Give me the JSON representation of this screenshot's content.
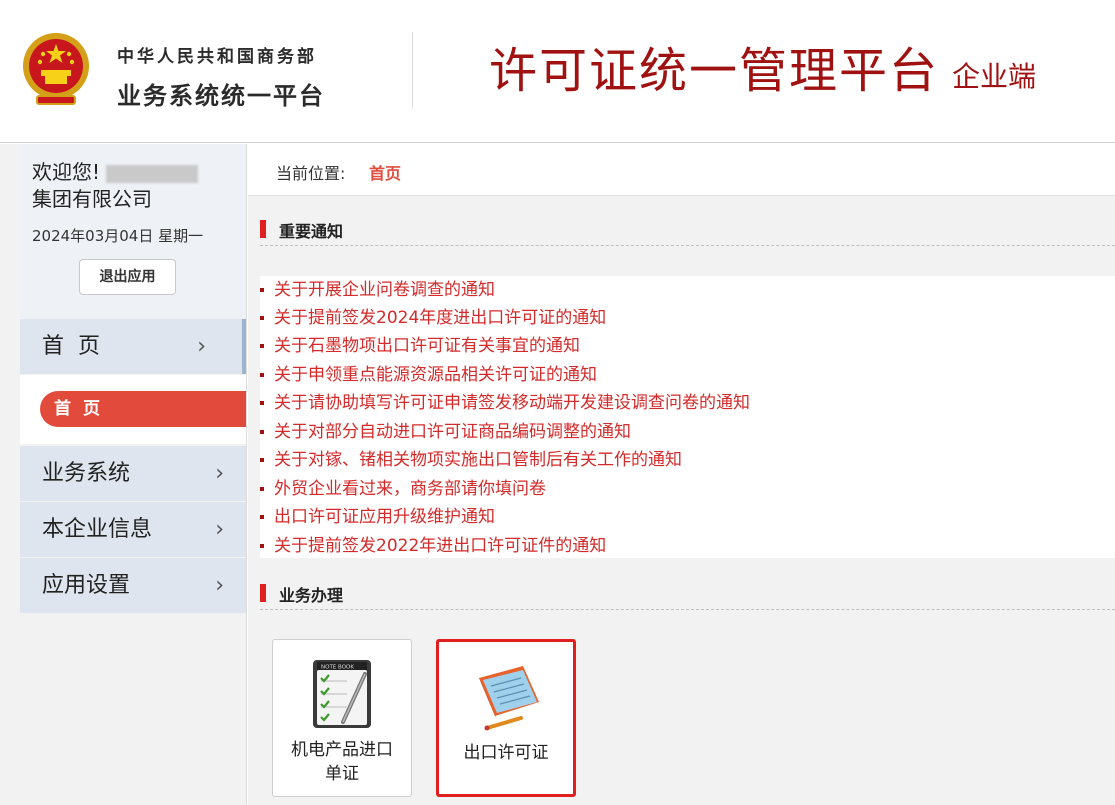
{
  "header": {
    "ministry_name": "中华人民共和国商务部",
    "ministry_sub": "业务系统统一平台",
    "platform_title": "许可证统一管理平台",
    "platform_sub": "企业端"
  },
  "user": {
    "welcome": "欢迎您!",
    "company": "集团有限公司",
    "date": "2024年03月04日 星期一",
    "logout_label": "退出应用"
  },
  "nav": {
    "home": "首页",
    "home_sub": "首页",
    "business": "业务系统",
    "company_info": "本企业信息",
    "settings": "应用设置"
  },
  "breadcrumb": {
    "label": "当前位置:",
    "current": "首页"
  },
  "sections": {
    "notices_title": "重要通知",
    "business_title": "业务办理"
  },
  "notices": [
    "关于开展企业问卷调查的通知",
    "关于提前签发2024年度进出口许可证的通知",
    "关于石墨物项出口许可证有关事宜的通知",
    "关于申领重点能源资源品相关许可证的通知",
    "关于请协助填写许可证申请签发移动端开发建设调查问卷的通知",
    "关于对部分自动进口许可证商品编码调整的通知",
    "关于对镓、锗相关物项实施出口管制后有关工作的通知",
    "外贸企业看过来，商务部请你填问卷",
    "出口许可证应用升级维护通知",
    "关于提前签发2022年进出口许可证件的通知"
  ],
  "tiles": [
    {
      "label": "机电产品进口单证",
      "icon": "notebook-icon"
    },
    {
      "label": "出口许可证",
      "icon": "license-notebook-icon"
    }
  ],
  "colors": {
    "brand_red": "#a01212",
    "accent_red": "#e24b3b",
    "link_red": "#d42a2a"
  }
}
